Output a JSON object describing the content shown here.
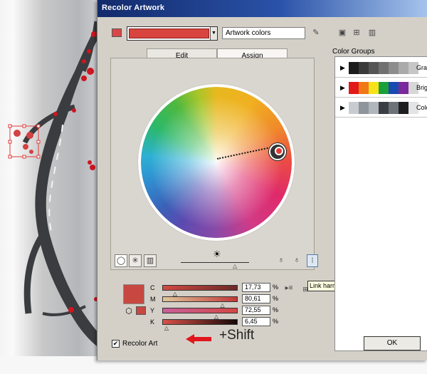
{
  "dialog": {
    "title": "Recolor Artwork",
    "artwork_name": "Artwork colors",
    "tabs": [
      {
        "label": "Edit",
        "active": true
      },
      {
        "label": "Assign",
        "active": false
      }
    ],
    "current_color": "#d8453f"
  },
  "color_groups": {
    "label": "Color Groups",
    "groups": [
      {
        "name": "Gra",
        "swatches": [
          "#1c1c1c",
          "#393939",
          "#555555",
          "#717171",
          "#8d8d8d",
          "#aaaaaa",
          "#c6c6c6"
        ]
      },
      {
        "name": "Brig",
        "swatches": [
          "#e01a1a",
          "#f07818",
          "#f6e21a",
          "#1aa03a",
          "#1a4ab0",
          "#7a2a9a",
          "#d7d7d7"
        ]
      },
      {
        "name": "Colo",
        "swatches": [
          "#c8ccd0",
          "#8e959c",
          "#b0b6bb",
          "#3a3e44",
          "#6c7278",
          "#1c1e20",
          "#e2e4e6"
        ]
      }
    ]
  },
  "cmyk": [
    {
      "label": "C",
      "value": "17,73",
      "unit": "%",
      "fraction": 0.1773
    },
    {
      "label": "M",
      "value": "80,61",
      "unit": "%",
      "fraction": 0.8061
    },
    {
      "label": "Y",
      "value": "72,55",
      "unit": "%",
      "fraction": 0.7255
    },
    {
      "label": "K",
      "value": "6,45",
      "unit": "%",
      "fraction": 0.0645
    }
  ],
  "tooltip": "Link harmony colors",
  "recolor_art": {
    "label": "Recolor Art",
    "checked": true
  },
  "annotation": {
    "shift_text": "+Shift",
    "arrow_color": "#e0161c"
  },
  "buttons": {
    "ok": "OK"
  }
}
